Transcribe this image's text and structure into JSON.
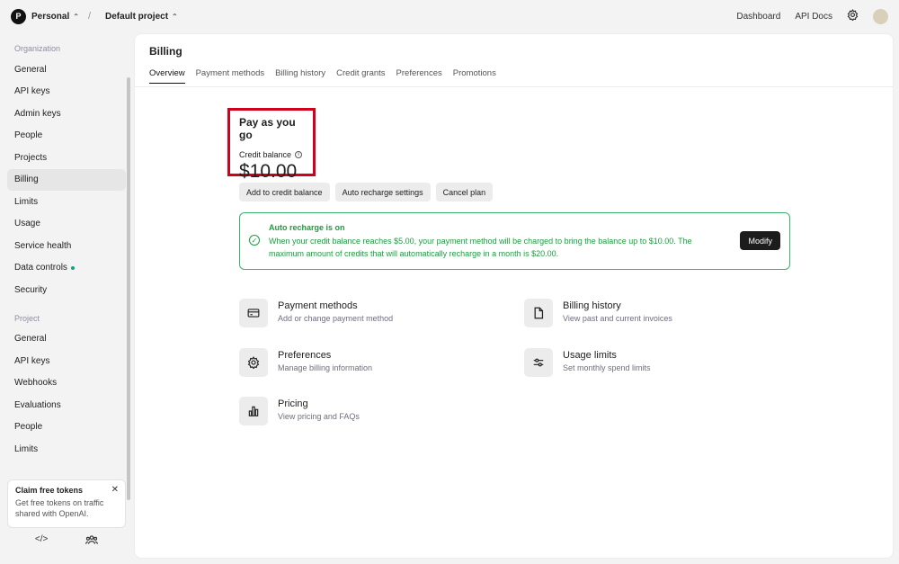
{
  "topbar": {
    "org_initial": "P",
    "org_name": "Personal",
    "separator": "/",
    "project_name": "Default project",
    "links": [
      "Dashboard",
      "API Docs"
    ]
  },
  "sidebar": {
    "org_section": "Organization",
    "org_items": [
      "General",
      "API keys",
      "Admin keys",
      "People",
      "Projects",
      "Billing",
      "Limits",
      "Usage",
      "Service health",
      "Data controls",
      "Security"
    ],
    "project_section": "Project",
    "project_items": [
      "General",
      "API keys",
      "Webhooks",
      "Evaluations",
      "People",
      "Limits"
    ],
    "active_item": "Billing",
    "claim": {
      "title": "Claim free tokens",
      "text": "Get free tokens on traffic shared with OpenAI."
    }
  },
  "main": {
    "title": "Billing",
    "tabs": [
      "Overview",
      "Payment methods",
      "Billing history",
      "Credit grants",
      "Preferences",
      "Promotions"
    ],
    "active_tab": "Overview",
    "plan": {
      "title": "Pay as you go",
      "credit_label": "Credit balance",
      "balance": "$10.00"
    },
    "buttons": [
      "Add to credit balance",
      "Auto recharge settings",
      "Cancel plan"
    ],
    "recharge": {
      "title": "Auto recharge is on",
      "text": "When your credit balance reaches $5.00, your payment method will be charged to bring the balance up to $10.00. The maximum amount of credits that will automatically recharge in a month is $20.00.",
      "button": "Modify"
    },
    "cards": [
      {
        "title": "Payment methods",
        "desc": "Add or change payment method",
        "icon": "credit-card-icon"
      },
      {
        "title": "Billing history",
        "desc": "View past and current invoices",
        "icon": "document-icon"
      },
      {
        "title": "Preferences",
        "desc": "Manage billing information",
        "icon": "gear-icon"
      },
      {
        "title": "Usage limits",
        "desc": "Set monthly spend limits",
        "icon": "sliders-icon"
      },
      {
        "title": "Pricing",
        "desc": "View pricing and FAQs",
        "icon": "bar-chart-icon"
      }
    ]
  }
}
